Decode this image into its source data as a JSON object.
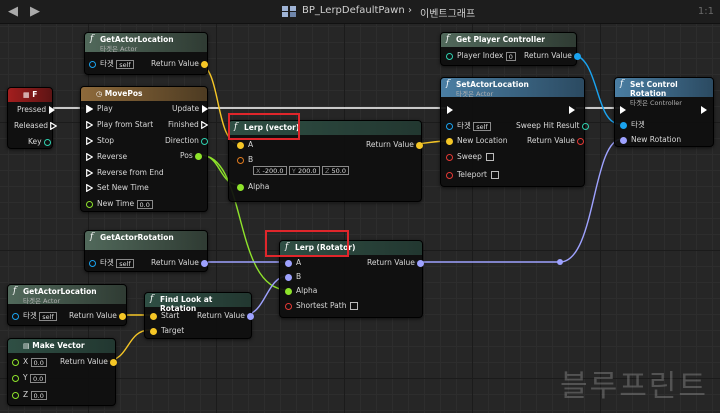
{
  "window": {
    "title": "BP_LerpDefaultPawn",
    "breadcrumb_sep": "›",
    "graph_name": "이벤트그래프",
    "zoom": "1:1",
    "watermark": "블루프린트"
  },
  "nodes": {
    "key_f": {
      "title": "F",
      "pins": {
        "pressed": "Pressed",
        "released": "Released",
        "key": "Key"
      }
    },
    "get_actor_location_1": {
      "title": "GetActorLocation",
      "subtitle": "타겟은 Actor",
      "target_label": "타겟",
      "target_value": "self",
      "return_label": "Return Value"
    },
    "move_pos": {
      "title": "MovePos",
      "inputs": [
        "Play",
        "Play from Start",
        "Stop",
        "Reverse",
        "Reverse from End",
        "Set New Time",
        "New Time"
      ],
      "new_time_value": "0.0",
      "outputs": {
        "update": "Update",
        "finished": "Finished",
        "direction": "Direction",
        "pos": "Pos"
      }
    },
    "lerp_vector": {
      "title": "Lerp (vector)",
      "a": "A",
      "b": "B",
      "alpha": "Alpha",
      "return_label": "Return Value",
      "b_x_label": "X",
      "b_x": "-200.0",
      "b_y_label": "Y",
      "b_y": "200.0",
      "b_z_label": "Z",
      "b_z": "50.0"
    },
    "get_player_controller": {
      "title": "Get Player Controller",
      "player_index_label": "Player Index",
      "player_index": "0",
      "return_label": "Return Value"
    },
    "set_actor_location": {
      "title": "SetActorLocation",
      "subtitle": "타겟은 Actor",
      "target_label": "타겟",
      "target_value": "self",
      "new_location": "New Location",
      "sweep": "Sweep",
      "teleport": "Teleport",
      "sweep_hit": "Sweep Hit Result",
      "return_label": "Return Value"
    },
    "set_control_rotation": {
      "title": "Set Control Rotation",
      "subtitle": "타겟은 Controller",
      "target_label": "타겟",
      "new_rotation": "New Rotation"
    },
    "get_actor_rotation": {
      "title": "GetActorRotation",
      "target_label": "타겟",
      "target_value": "self",
      "return_label": "Return Value"
    },
    "lerp_rotator": {
      "title": "Lerp (Rotator)",
      "a": "A",
      "b": "B",
      "alpha": "Alpha",
      "shortest_path": "Shortest Path",
      "return_label": "Return Value"
    },
    "get_actor_location_2": {
      "title": "GetActorLocation",
      "subtitle": "타겟은 Actor",
      "target_label": "타겟",
      "target_value": "self",
      "return_label": "Return Value"
    },
    "find_look_at": {
      "title": "Find Look at Rotation",
      "start": "Start",
      "target": "Target",
      "return_label": "Return Value"
    },
    "make_vector": {
      "title": "Make Vector",
      "x_label": "X",
      "x": "0.0",
      "y_label": "Y",
      "y": "0.0",
      "z_label": "Z",
      "z": "0.0",
      "return_label": "Return Value"
    }
  },
  "colors": {
    "exec": "#ffffff",
    "vector": "#f5c626",
    "float": "#8ee32b",
    "object": "#1aa3ef",
    "rotator": "#9ea2ff",
    "struct": "#2fd1b0",
    "bool": "#e53935",
    "highlight": "#e0262b"
  }
}
